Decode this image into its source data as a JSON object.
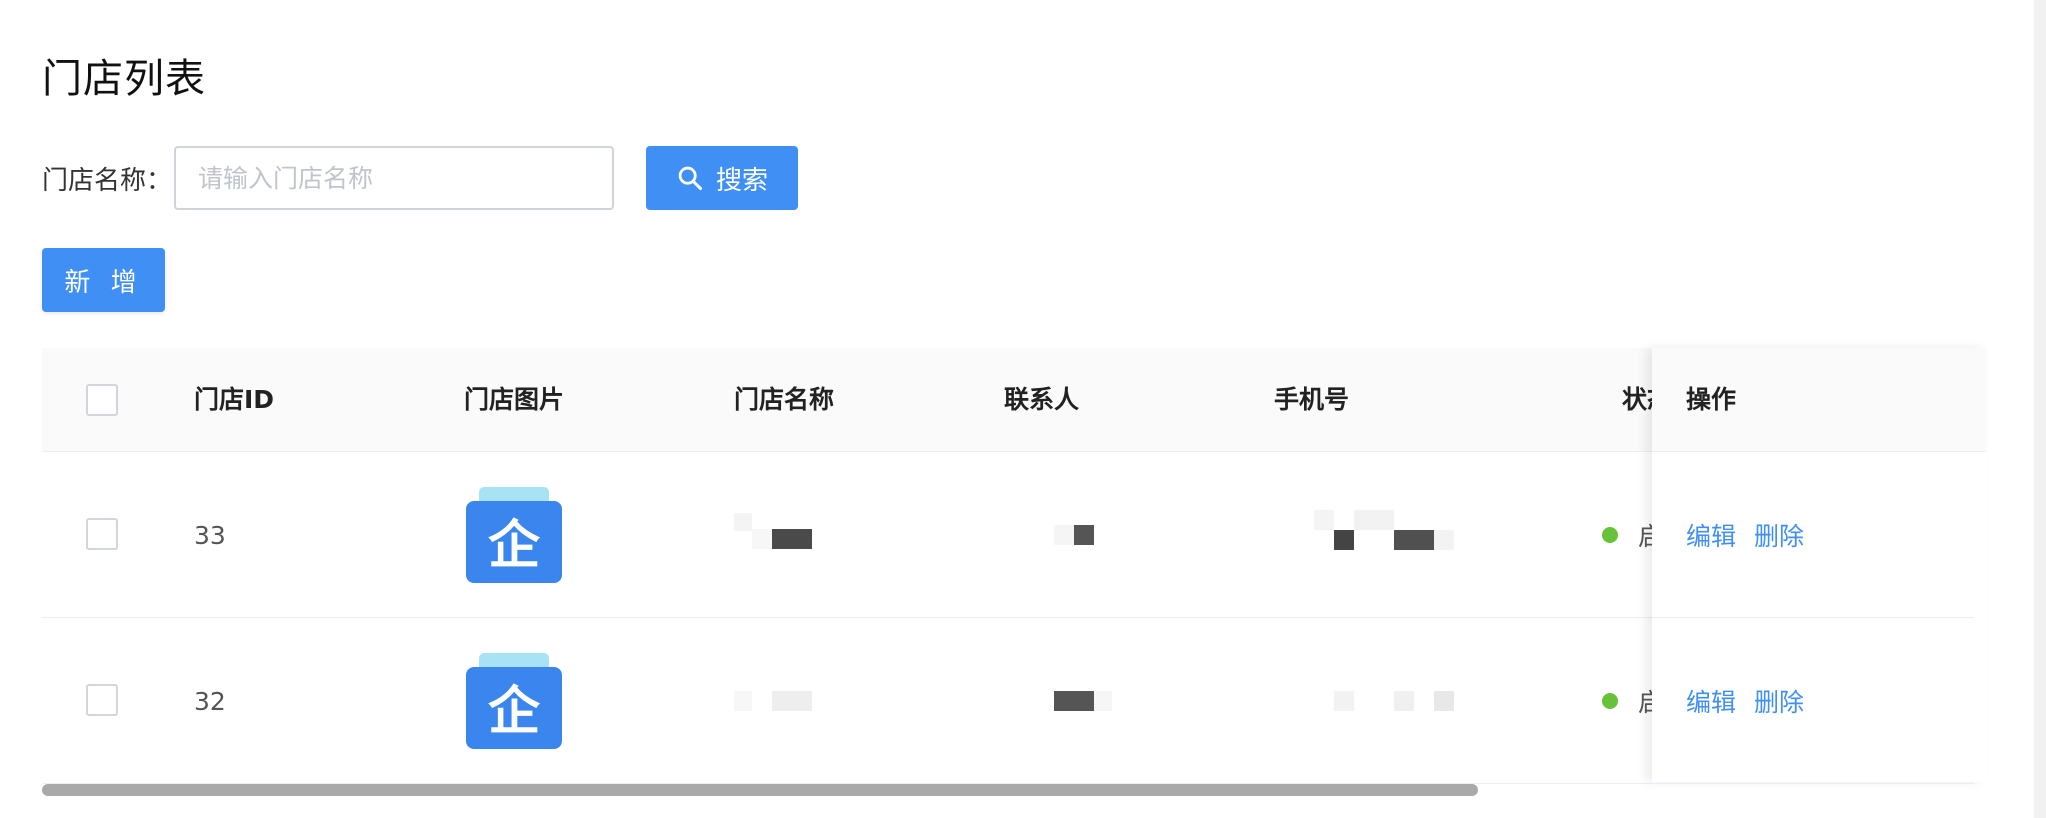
{
  "page": {
    "title": "门店列表"
  },
  "search": {
    "label": "门店名称：",
    "placeholder": "请输入门店名称",
    "value": "",
    "button_label": "搜索"
  },
  "toolbar": {
    "add_label": "新 增"
  },
  "table": {
    "columns": [
      "门店ID",
      "门店图片",
      "门店名称",
      "联系人",
      "手机号",
      "状态",
      "操作"
    ],
    "rows": [
      {
        "id": "33",
        "image": "store-logo-企",
        "name": "",
        "contact": "",
        "phone": "",
        "status": "启",
        "actions": [
          "编辑",
          "删除"
        ]
      },
      {
        "id": "32",
        "image": "store-logo-企",
        "name": "",
        "contact": "",
        "phone": "",
        "status": "启",
        "actions": [
          "编辑",
          "删除"
        ]
      }
    ]
  },
  "colors": {
    "primary": "#3f8ff5",
    "status_on": "#67c23a",
    "header_bg": "#fafafa"
  },
  "logo_glyph": "企"
}
